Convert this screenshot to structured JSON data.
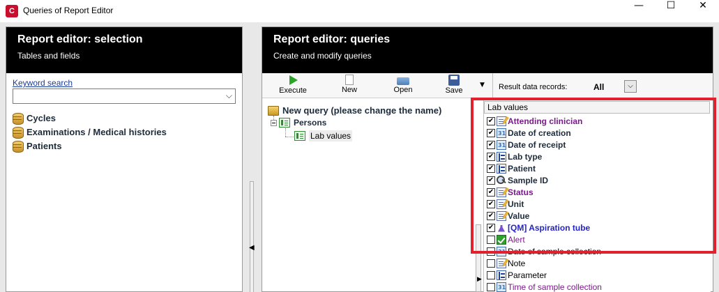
{
  "window": {
    "icon_glyph": "C",
    "title": "Queries of Report Editor",
    "minimize": "—",
    "maximize": "☐",
    "close": "✕"
  },
  "left_panel": {
    "title": "Report editor: selection",
    "subtitle": "Tables and fields",
    "keyword_label": "Keyword search",
    "keyword_value": "",
    "dropdown_glyph": "⌵",
    "items": [
      {
        "label": "Cycles",
        "icon": "database-icon"
      },
      {
        "label": "Examinations / Medical histories",
        "icon": "database-icon"
      },
      {
        "label": "Patients",
        "icon": "database-icon"
      }
    ]
  },
  "right_panel": {
    "title": "Report editor: queries",
    "subtitle": "Create and modify queries",
    "toolbar": {
      "execute": "Execute",
      "new": "New",
      "open": "Open",
      "save": "Save",
      "more_glyph": "▼"
    },
    "result": {
      "label": "Result data records:",
      "value": "All",
      "dropdown_glyph": "⌵"
    },
    "query_tree": {
      "query_name": "New query (please change the name)",
      "table": "Persons",
      "subtable": "Lab values"
    },
    "field_list": {
      "header": "Lab values",
      "check_glyph": "✔",
      "fields": [
        {
          "label": "Attending clinician",
          "checked": true,
          "icon": "text-icon",
          "color": "#7a1a8a",
          "bold": true
        },
        {
          "label": "Date of creation",
          "checked": true,
          "icon": "date-icon",
          "color": "#1e2b3a",
          "bold": true
        },
        {
          "label": "Date of receipt",
          "checked": true,
          "icon": "date-icon",
          "color": "#1e2b3a",
          "bold": true
        },
        {
          "label": "Lab type",
          "checked": true,
          "icon": "link-icon",
          "color": "#1e2b3a",
          "bold": true
        },
        {
          "label": "Patient",
          "checked": true,
          "icon": "link-icon",
          "color": "#1e2b3a",
          "bold": true
        },
        {
          "label": "Sample ID",
          "checked": true,
          "icon": "key-icon",
          "color": "#1e2b3a",
          "bold": true
        },
        {
          "label": "Status",
          "checked": true,
          "icon": "text-icon",
          "color": "#7a1a8a",
          "bold": true
        },
        {
          "label": "Unit",
          "checked": true,
          "icon": "text-icon",
          "color": "#1e2b3a",
          "bold": true
        },
        {
          "label": "Value",
          "checked": true,
          "icon": "text-icon",
          "color": "#1e2b3a",
          "bold": true
        },
        {
          "label": "[QM] Aspiration tube",
          "checked": true,
          "icon": "flask-icon",
          "color": "#2424c8",
          "bold": true
        },
        {
          "label": "Alert",
          "checked": false,
          "icon": "check-icon",
          "color": "#7a1a8a",
          "bold": false
        },
        {
          "label": "Date of sample collection",
          "checked": false,
          "icon": "date-icon",
          "color": "#000000",
          "bold": false
        },
        {
          "label": "Note",
          "checked": false,
          "icon": "text-icon",
          "color": "#000000",
          "bold": false
        },
        {
          "label": "Parameter",
          "checked": false,
          "icon": "link-icon",
          "color": "#000000",
          "bold": false
        },
        {
          "label": "Time of sample collection",
          "checked": false,
          "icon": "date-icon",
          "color": "#7a1a8a",
          "bold": false
        }
      ]
    }
  },
  "splitter_glyph": "◀",
  "scroll_glyph": "▶",
  "highlight_color": "#e3202e"
}
